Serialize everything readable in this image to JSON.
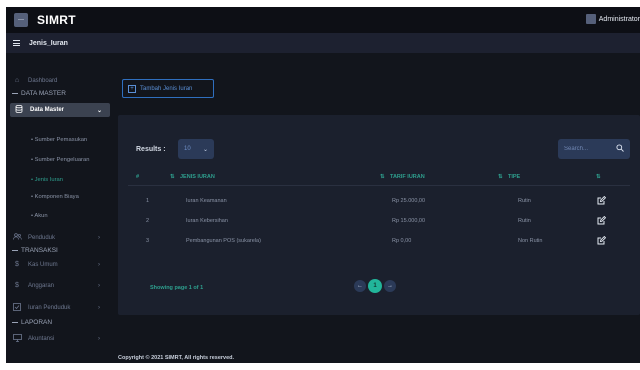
{
  "app": {
    "brand": "SIMRT",
    "logo_glyph": "—",
    "user": "Administrator"
  },
  "subbar": {
    "title": "Jenis_Iuran"
  },
  "sidebar": {
    "dashboard": "Dashboard",
    "section_master": "DATA MASTER",
    "data_master": "Data Master",
    "sub_items": [
      "Sumber Pemasukan",
      "Sumber Pengeluaran",
      "Jenis Iuran",
      "Komponen Biaya",
      "Akun"
    ],
    "penduduk": "Penduduk",
    "section_transaksi": "TRANSAKSI",
    "kas_umum": "Kas Umum",
    "anggaran": "Anggaran",
    "iuran_penduduk": "Iuran Penduduk",
    "section_laporan": "LAPORAN",
    "akuntansi": "Akuntansi"
  },
  "toolbar": {
    "add_label": "Tambah Jenis Iuran"
  },
  "table": {
    "results_label": "Results :",
    "page_size": "10",
    "search_placeholder": "Search...",
    "headers": {
      "no": "#",
      "jenis": "JENIS IURAN",
      "tarif": "TARIF IURAN",
      "tipe": "TIPE",
      "aksi": ""
    },
    "sort_glyph": "⇅",
    "rows": [
      {
        "no": "1",
        "jenis": "Iuran Keamanan",
        "tarif": "Rp 25.000,00",
        "tipe": "Rutin"
      },
      {
        "no": "2",
        "jenis": "Iuran Kebersihan",
        "tarif": "Rp 15.000,00",
        "tipe": "Rutin"
      },
      {
        "no": "3",
        "jenis": "Pembangunan POS (sukarela)",
        "tarif": "Rp 0,00",
        "tipe": "Non Rutin"
      }
    ],
    "showing": "Showing page 1 of 1",
    "current_page": "1",
    "prev_glyph": "←",
    "next_glyph": "→"
  },
  "footer": {
    "text": "Copyright © 2021 SIMRT, All rights reserved."
  },
  "colors": {
    "accent": "#22b59a",
    "link": "#2f6fbf",
    "bg": "#12151c",
    "panel": "#1b202d"
  }
}
